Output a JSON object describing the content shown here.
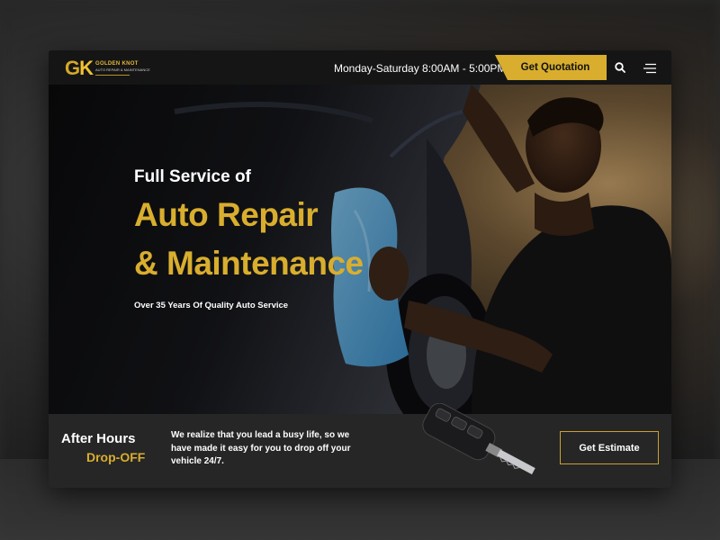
{
  "header": {
    "logo": {
      "mark_g": "G",
      "mark_k": "K",
      "name": "GOLDEN KNOT",
      "tagline": "AUTO REPAIR & MAINTENANCE"
    },
    "hours": "Monday-Saturday 8:00AM - 5:00PM",
    "quote_label": "Get Quotation",
    "icons": [
      "search-icon",
      "menu-icon"
    ]
  },
  "hero": {
    "subtitle": "Full Service of",
    "title_line1": "Auto Repair",
    "title_line2": "& Maintenance",
    "tagline": "Over 35 Years Of Quality Auto Service"
  },
  "bottom": {
    "title": "After Hours",
    "subtitle": "Drop-OFF",
    "text": "We realize that you lead a busy life, so we have made it easy for you to drop off your vehicle 24/7.",
    "estimate_label": "Get Estimate"
  },
  "colors": {
    "accent": "#d9ae2e",
    "header_bg": "#151515",
    "bottom_bg": "#262626",
    "text": "#ffffff"
  }
}
